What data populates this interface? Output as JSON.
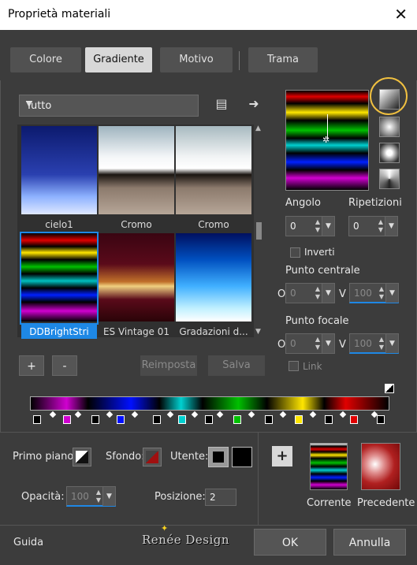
{
  "window": {
    "title": "Proprietà materiali",
    "close_icon": "close-icon"
  },
  "tabs": [
    {
      "label": "Colore"
    },
    {
      "label": "Gradiente",
      "active": true
    },
    {
      "label": "Motivo"
    },
    {
      "label": "Trama"
    }
  ],
  "category": {
    "selected": "Tutto"
  },
  "gradients": [
    {
      "label": "cielo1"
    },
    {
      "label": "Cromo"
    },
    {
      "label": "Cromo"
    },
    {
      "label": "DDBrightStri",
      "selected": true
    },
    {
      "label": "ES Vintage 01"
    },
    {
      "label": "Gradazioni d..."
    }
  ],
  "buttons": {
    "add": "+",
    "remove": "-",
    "reset": "Reimposta",
    "save": "Salva"
  },
  "settings": {
    "angle_label": "Angolo",
    "angle_value": "0",
    "repeats_label": "Ripetizioni",
    "repeats_value": "0",
    "invert_label": "Inverti",
    "center_label": "Punto centrale",
    "focal_label": "Punto focale",
    "o_label": "O",
    "v_label": "V",
    "center_o": "0",
    "center_v": "100",
    "focal_o": "0",
    "focal_v": "100",
    "link_label": "Link"
  },
  "bottom": {
    "foreground_label": "Primo piano:",
    "background_label": "Sfondo:",
    "user_label": "Utente:",
    "opacity_label": "Opacità:",
    "opacity_value": "100",
    "position_label": "Posizione:",
    "position_value": "2",
    "current_label": "Corrente",
    "previous_label": "Precedente"
  },
  "footer": {
    "help": "Guida",
    "ok": "OK",
    "cancel": "Annulla",
    "watermark": "Renée Design"
  }
}
